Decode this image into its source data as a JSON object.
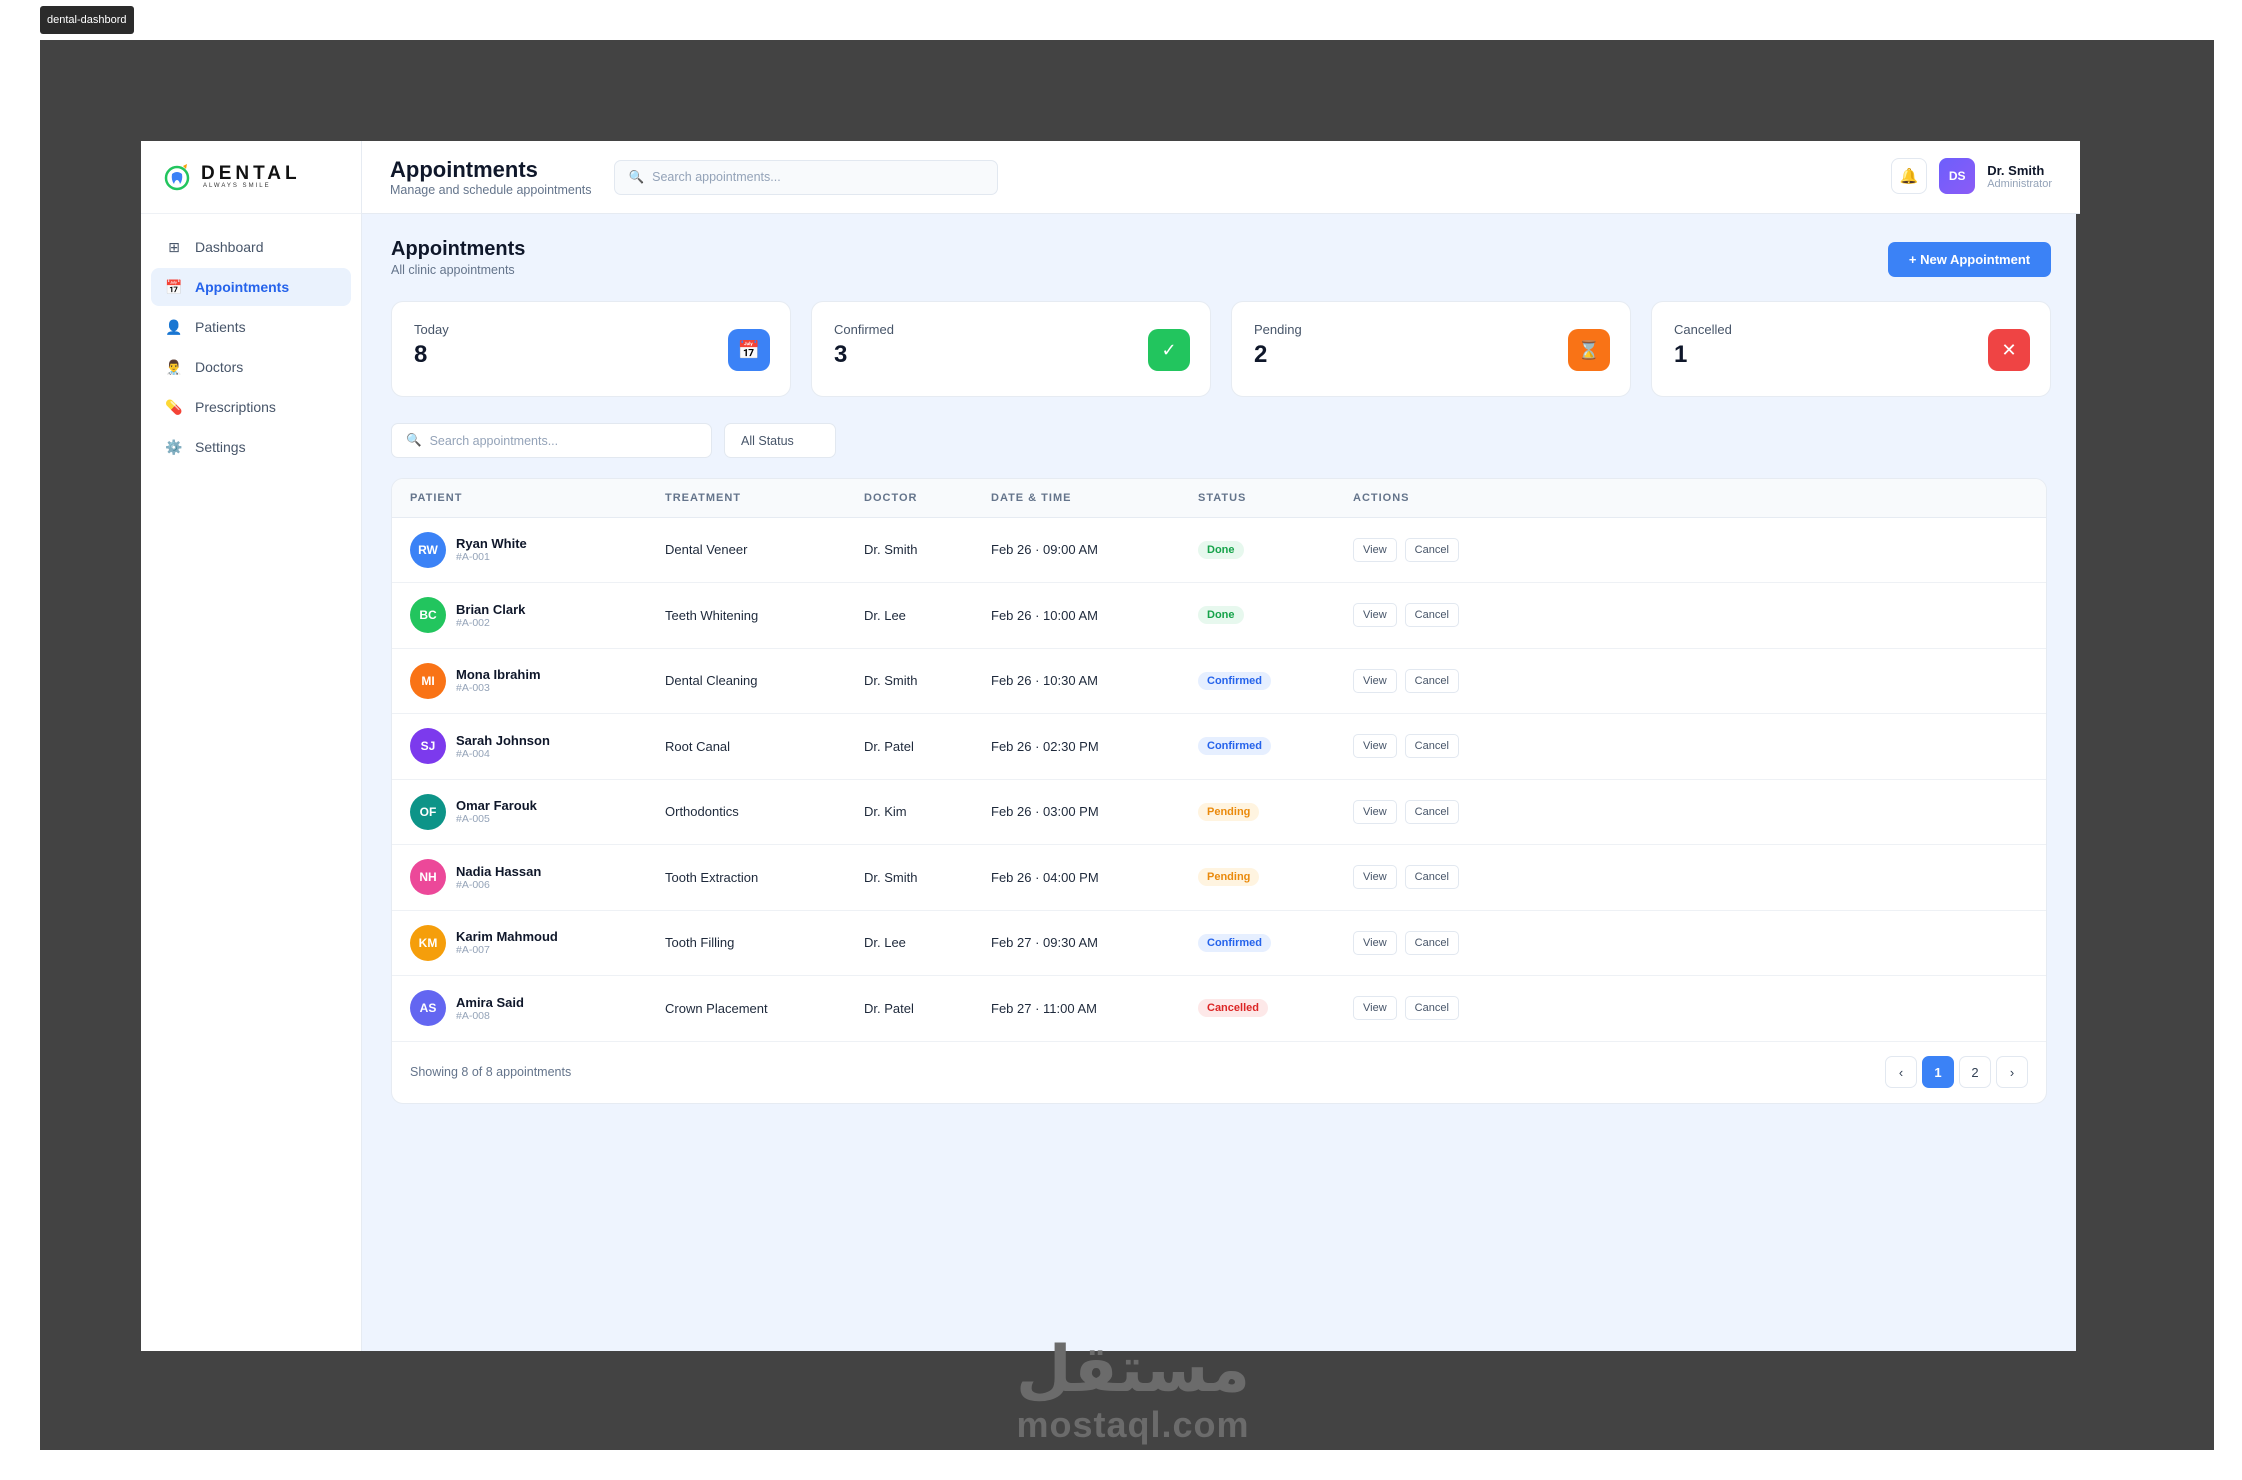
{
  "frame_tag": "dental-dashbord",
  "brand": {
    "name": "DENTAL",
    "tagline": "ALWAYS SMILE"
  },
  "sidebar": {
    "items": [
      {
        "label": "Dashboard",
        "icon": "grid-icon",
        "glyph": "⊞"
      },
      {
        "label": "Appointments",
        "icon": "calendar-icon",
        "glyph": "📅"
      },
      {
        "label": "Patients",
        "icon": "user-icon",
        "glyph": "👤"
      },
      {
        "label": "Doctors",
        "icon": "doctor-icon",
        "glyph": "👨‍⚕️"
      },
      {
        "label": "Prescriptions",
        "icon": "pill-icon",
        "glyph": "💊"
      },
      {
        "label": "Settings",
        "icon": "gear-icon",
        "glyph": "⚙️"
      }
    ],
    "active_index": 1
  },
  "topbar": {
    "title": "Appointments",
    "subtitle": "Manage and schedule appointments",
    "search_placeholder": "Search appointments...",
    "user": {
      "initials": "DS",
      "name": "Dr. Smith",
      "role": "Administrator"
    }
  },
  "page": {
    "title": "Appointments",
    "subtitle": "All clinic appointments",
    "new_button": "+ New Appointment"
  },
  "stats": [
    {
      "label": "Today",
      "value": "8",
      "icon": "calendar-icon",
      "glyph": "📅",
      "color": "#3b82f6"
    },
    {
      "label": "Confirmed",
      "value": "3",
      "icon": "check-icon",
      "glyph": "✓",
      "color": "#22c55e"
    },
    {
      "label": "Pending",
      "value": "2",
      "icon": "hourglass-icon",
      "glyph": "⌛",
      "color": "#f97316"
    },
    {
      "label": "Cancelled",
      "value": "1",
      "icon": "x-icon",
      "glyph": "✕",
      "color": "#ef4444"
    }
  ],
  "filters": {
    "search_placeholder": "Search appointments...",
    "status_select": "All Status"
  },
  "table": {
    "columns": [
      "PATIENT",
      "TREATMENT",
      "DOCTOR",
      "DATE & TIME",
      "STATUS",
      "ACTIONS"
    ],
    "rows": [
      {
        "initials": "RW",
        "name": "Ryan White",
        "id": "#A-001",
        "treatment": "Dental Veneer",
        "doctor": "Dr. Smith",
        "datetime": "Feb 26 · 09:00 AM",
        "status": "Done",
        "color": "#3b82f6"
      },
      {
        "initials": "BC",
        "name": "Brian Clark",
        "id": "#A-002",
        "treatment": "Teeth Whitening",
        "doctor": "Dr. Lee",
        "datetime": "Feb 26 · 10:00 AM",
        "status": "Done",
        "color": "#22c55e"
      },
      {
        "initials": "MI",
        "name": "Mona Ibrahim",
        "id": "#A-003",
        "treatment": "Dental Cleaning",
        "doctor": "Dr. Smith",
        "datetime": "Feb 26 · 10:30 AM",
        "status": "Confirmed",
        "color": "#f97316"
      },
      {
        "initials": "SJ",
        "name": "Sarah Johnson",
        "id": "#A-004",
        "treatment": "Root Canal",
        "doctor": "Dr. Patel",
        "datetime": "Feb 26 · 02:30 PM",
        "status": "Confirmed",
        "color": "#7c3aed"
      },
      {
        "initials": "OF",
        "name": "Omar Farouk",
        "id": "#A-005",
        "treatment": "Orthodontics",
        "doctor": "Dr. Kim",
        "datetime": "Feb 26 · 03:00 PM",
        "status": "Pending",
        "color": "#0d9488"
      },
      {
        "initials": "NH",
        "name": "Nadia Hassan",
        "id": "#A-006",
        "treatment": "Tooth Extraction",
        "doctor": "Dr. Smith",
        "datetime": "Feb 26 · 04:00 PM",
        "status": "Pending",
        "color": "#ec4899"
      },
      {
        "initials": "KM",
        "name": "Karim Mahmoud",
        "id": "#A-007",
        "treatment": "Tooth Filling",
        "doctor": "Dr. Lee",
        "datetime": "Feb 27 · 09:30 AM",
        "status": "Confirmed",
        "color": "#f59e0b"
      },
      {
        "initials": "AS",
        "name": "Amira Said",
        "id": "#A-008",
        "treatment": "Crown Placement",
        "doctor": "Dr. Patel",
        "datetime": "Feb 27 · 11:00 AM",
        "status": "Cancelled",
        "color": "#6366f1"
      }
    ],
    "action_labels": {
      "view": "View",
      "cancel": "Cancel"
    },
    "footer": "Showing 8 of 8 appointments",
    "pagination": {
      "prev": "‹",
      "pages": [
        "1",
        "2"
      ],
      "current": "1",
      "next": "›"
    }
  },
  "watermark": {
    "arabic": "مستقل",
    "latin": "mostaql.com"
  }
}
